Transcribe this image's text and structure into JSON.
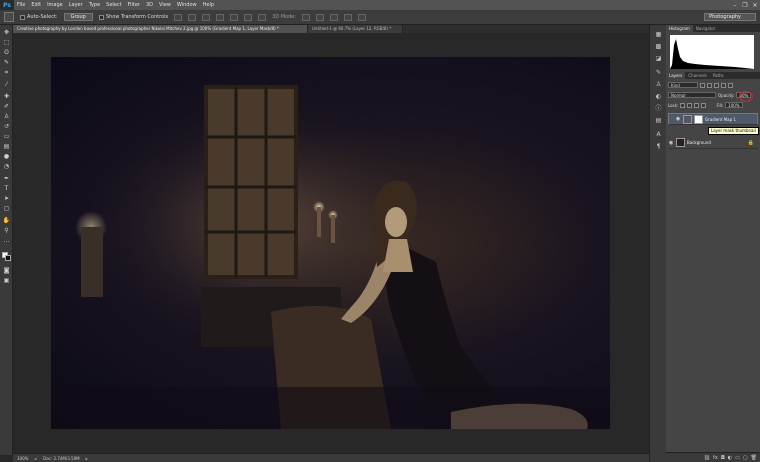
{
  "menu": {
    "logo": "Ps",
    "items": [
      "File",
      "Edit",
      "Image",
      "Layer",
      "Type",
      "Select",
      "Filter",
      "3D",
      "View",
      "Window",
      "Help"
    ]
  },
  "options": {
    "auto_select_label": "Auto-Select:",
    "auto_select_target": "Group",
    "transform_controls_label": "Show Transform Controls",
    "mode_3d_label": "3D Mode:",
    "workspace": "Photography"
  },
  "tabs": [
    {
      "label": "Creative photography by London based professional photographer Nikolai Mitchev 2.jpg @ 100% (Gradient Map 1, Layer Mask/8) *"
    },
    {
      "label": "Untitled-1 @ 66.7% (Layer 12, RGB/8) *"
    }
  ],
  "status": {
    "zoom": "100%",
    "doc": "Doc: 2.74M/3.59M"
  },
  "panels": {
    "histogram_tabs": [
      "Histogram",
      "Navigator"
    ],
    "layers_tabs": [
      "Layers",
      "Channels",
      "Paths"
    ],
    "kind_label": "Kind",
    "blend_mode": "Normal",
    "opacity_label": "Opacity:",
    "opacity_value": "60%",
    "lock_label": "Lock:",
    "fill_label": "Fill:",
    "fill_value": "100%",
    "layers": [
      {
        "name": "Gradient Map 1"
      },
      {
        "name": "Background"
      }
    ],
    "tooltip": "Layer mask thumbnail"
  },
  "colors": {
    "accent": "#31a8ff",
    "highlight_circle": "#e02020"
  }
}
